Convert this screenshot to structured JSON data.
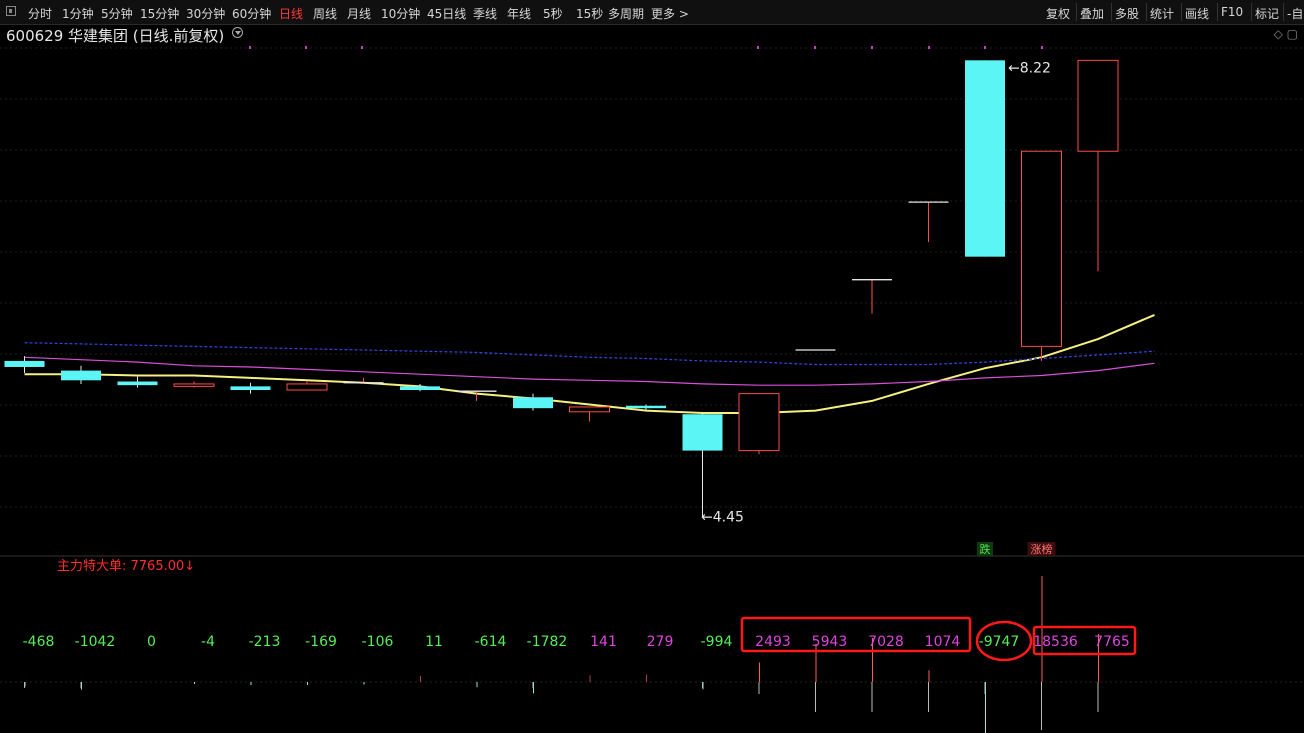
{
  "toolbar": {
    "left_items": [
      {
        "label": "分时",
        "active": false
      },
      {
        "label": "1分钟",
        "active": false
      },
      {
        "label": "5分钟",
        "active": false
      },
      {
        "label": "15分钟",
        "active": false
      },
      {
        "label": "30分钟",
        "active": false
      },
      {
        "label": "60分钟",
        "active": false
      },
      {
        "label": "日线",
        "active": true
      },
      {
        "label": "周线",
        "active": false
      },
      {
        "label": "月线",
        "active": false
      },
      {
        "label": "10分钟",
        "active": false
      },
      {
        "label": "45日线",
        "active": false
      },
      {
        "label": "季线",
        "active": false
      },
      {
        "label": "年线",
        "active": false
      },
      {
        "label": "5秒",
        "active": false
      },
      {
        "label": "15秒",
        "active": false
      },
      {
        "label": "多周期",
        "active": false
      },
      {
        "label": "更多 >",
        "active": false
      }
    ],
    "right_items": [
      "复权",
      "叠加",
      "多股",
      "统计",
      "画线",
      "F10",
      "标记",
      "-自"
    ]
  },
  "title": "600629 华建集团 (日线.前复权)",
  "chart_data": {
    "type": "candlestick",
    "candles": [
      {
        "open": 5.74,
        "close": 5.69,
        "high": 5.78,
        "low": 5.64
      },
      {
        "open": 5.66,
        "close": 5.58,
        "high": 5.7,
        "low": 5.55
      },
      {
        "open": 5.57,
        "close": 5.54,
        "high": 5.61,
        "low": 5.52
      },
      {
        "open": 5.53,
        "close": 5.55,
        "high": 5.57,
        "low": 5.52
      },
      {
        "open": 5.53,
        "close": 5.5,
        "high": 5.56,
        "low": 5.47
      },
      {
        "open": 5.5,
        "close": 5.55,
        "high": 5.57,
        "low": 5.5
      },
      {
        "open": 5.56,
        "close": 5.56,
        "high": 5.6,
        "low": 5.55
      },
      {
        "open": 5.53,
        "close": 5.5,
        "high": 5.55,
        "low": 5.49
      },
      {
        "open": 5.49,
        "close": 5.49,
        "high": 5.49,
        "low": 5.41
      },
      {
        "open": 5.44,
        "close": 5.35,
        "high": 5.47,
        "low": 5.33
      },
      {
        "open": 5.32,
        "close": 5.36,
        "high": 5.36,
        "low": 5.24
      },
      {
        "open": 5.37,
        "close": 5.35,
        "high": 5.38,
        "low": 5.33
      },
      {
        "open": 5.3,
        "close": 5.0,
        "high": 5.31,
        "low": 4.45
      },
      {
        "open": 5.0,
        "close": 5.47,
        "high": 5.47,
        "low": 4.97
      },
      {
        "open": 5.83,
        "close": 5.83,
        "high": 5.83,
        "low": 5.83
      },
      {
        "open": 6.41,
        "close": 6.41,
        "high": 6.41,
        "low": 6.13
      },
      {
        "open": 7.05,
        "close": 7.05,
        "high": 7.05,
        "low": 6.72
      },
      {
        "open": 8.22,
        "close": 6.6,
        "high": 8.22,
        "low": 6.6
      },
      {
        "open": 5.86,
        "close": 7.47,
        "high": 7.47,
        "low": 5.74
      },
      {
        "open": 7.47,
        "close": 8.22,
        "high": 8.22,
        "low": 6.48
      }
    ],
    "ma_lines": [
      {
        "color": "#f5f080",
        "values": [
          5.63,
          5.63,
          5.62,
          5.62,
          5.6,
          5.58,
          5.56,
          5.53,
          5.47,
          5.43,
          5.38,
          5.33,
          5.31,
          5.31,
          5.33,
          5.41,
          5.55,
          5.68,
          5.77,
          5.92,
          6.12
        ]
      },
      {
        "color": "#d94fd9",
        "values": [
          5.77,
          5.75,
          5.73,
          5.7,
          5.69,
          5.67,
          5.65,
          5.63,
          5.61,
          5.59,
          5.58,
          5.57,
          5.55,
          5.54,
          5.54,
          5.55,
          5.57,
          5.6,
          5.62,
          5.66,
          5.72
        ]
      },
      {
        "color": "#3344dd",
        "values": [
          5.89,
          5.88,
          5.87,
          5.86,
          5.85,
          5.84,
          5.83,
          5.82,
          5.81,
          5.79,
          5.77,
          5.76,
          5.74,
          5.73,
          5.71,
          5.71,
          5.71,
          5.73,
          5.76,
          5.79,
          5.82
        ]
      }
    ],
    "price_labels": {
      "high": "8.22",
      "low": "4.45"
    },
    "indicator_label": "主力特大单: 7765.00",
    "indicator_values": [
      -468,
      -1042,
      0,
      -4,
      -213,
      -169,
      -106,
      11,
      -614,
      -1782,
      141,
      279,
      -994,
      2493,
      5943,
      7028,
      1074,
      -9747,
      18536,
      7765
    ],
    "badges": [
      {
        "index": 17,
        "text": "跌"
      },
      {
        "index": 18,
        "text": "涨榜"
      }
    ],
    "volume_bars": [
      1,
      1,
      0,
      0,
      0,
      0,
      0,
      0,
      0,
      1,
      0,
      0,
      1,
      2,
      5,
      5,
      5,
      2,
      8,
      5
    ],
    "grid": true
  }
}
